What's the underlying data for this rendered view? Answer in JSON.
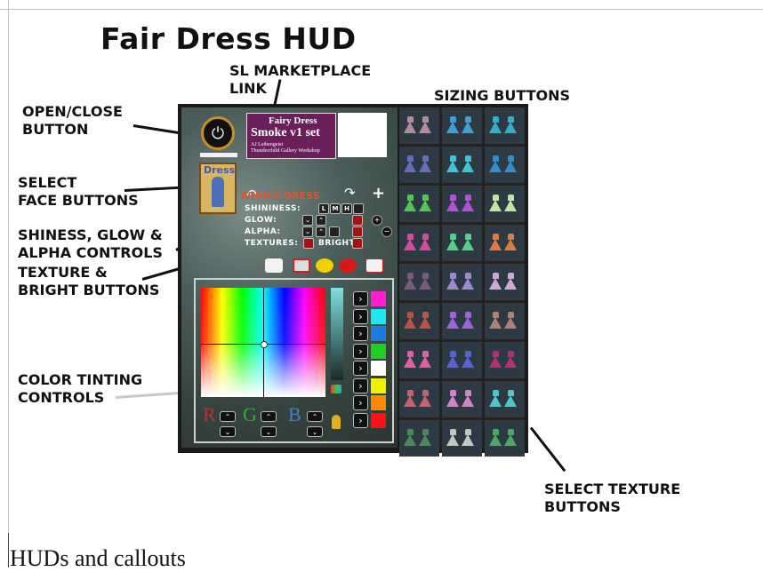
{
  "title": "Fair Dress HUD",
  "callouts": {
    "marketplace": "SL MARKETPLACE\nLINK",
    "open_close": "OPEN/CLOSE\nBUTTON",
    "sizing": "SIZING BUTTONS",
    "face": "SELECT\nFACE BUTTONS",
    "shiny": "SHINESS, GLOW &\nALPHA CONTROLS",
    "texture_bright": "TEXTURE &\nBRIGHT BUTTONS",
    "color": "COLOR TINTING\nCONTROLS",
    "select_texture": "SELECT TEXTURE\nBUTTONS"
  },
  "hud": {
    "marketplace_line1": "Fairy Dress",
    "marketplace_line2": "Smoke v1 set",
    "marketplace_line3": "AJ Leibengeist\nThunderchild Gallery Workshop",
    "face_button_label": "Dress",
    "whole_dress": "WHOLE DRESS",
    "shininess_label": "SHININESS:",
    "glow_label": "GLOW:",
    "alpha_label": "ALPHA:",
    "textures_label": "TEXTURES:",
    "bright_label": "BRIGHT:",
    "size_l": "L",
    "size_m": "M",
    "size_h": "H",
    "rgb": [
      "R",
      "G",
      "B"
    ],
    "swatches": [
      "#ff1fd0",
      "#1fe6f0",
      "#1f7be0",
      "#20d020",
      "#ffffff",
      "#f0f000",
      "#ff8a00",
      "#ff1010"
    ],
    "texture_colors": [
      [
        "#b48a9c",
        "#3fa0d8",
        "#2fb0d0"
      ],
      [
        "#6c6cbc",
        "#3ac6d8",
        "#2f8ed0"
      ],
      [
        "#50c850",
        "#b34fd8",
        "#c4e4a0"
      ],
      [
        "#d84a9a",
        "#55d08a",
        "#e07a40"
      ],
      [
        "#7a5c7a",
        "#9a8ad0",
        "#d0a8d8"
      ],
      [
        "#c05040",
        "#a060e0",
        "#b08070"
      ],
      [
        "#e060a0",
        "#5a60d8",
        "#b03070"
      ],
      [
        "#c86070",
        "#d880c8",
        "#4cc8c8"
      ],
      [
        "#4a8a5a",
        "#c0c8c0",
        "#4aa860"
      ]
    ]
  },
  "caption": "HUDs and callouts"
}
